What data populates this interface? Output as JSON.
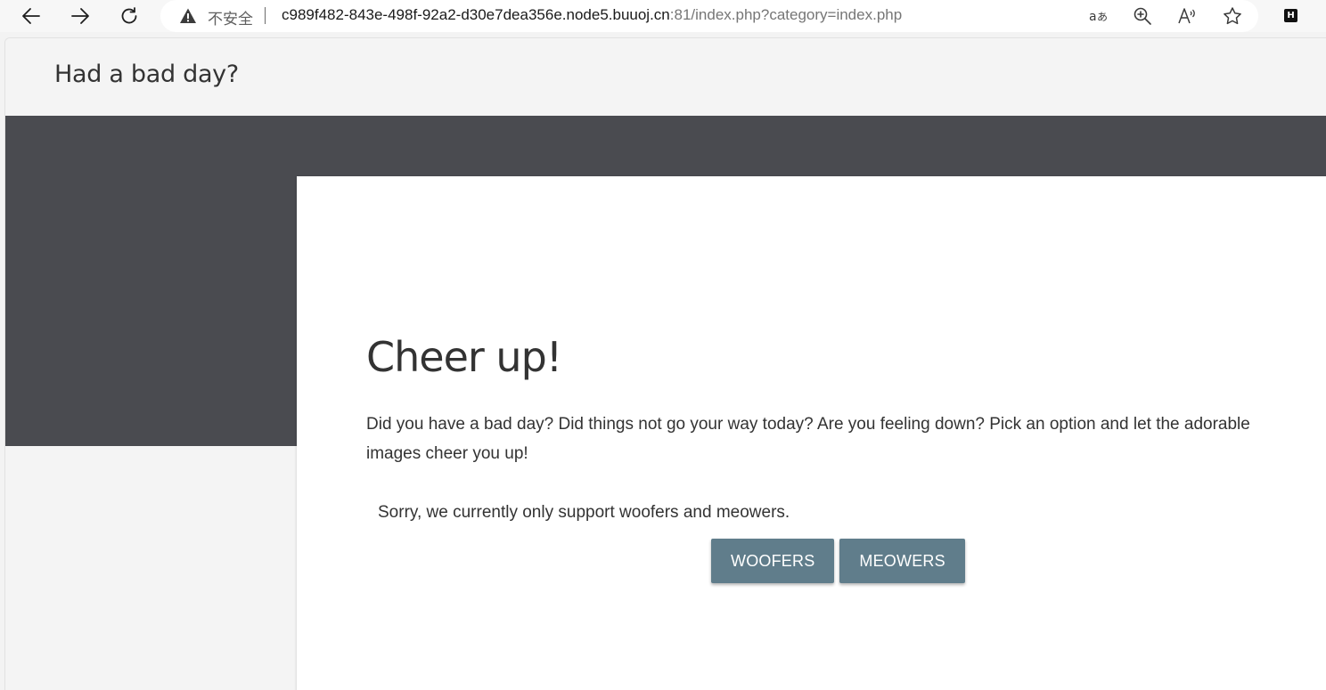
{
  "browser": {
    "security_label": "不安全",
    "url_host": "c989f482-843e-498f-92a2-d30e7dea356e.node5.buuoj.cn",
    "url_path": ":81/index.php?category=index.php",
    "icons": [
      "back-arrow-icon",
      "forward-arrow-icon",
      "refresh-icon",
      "warning-icon",
      "translate-icon",
      "zoom-icon",
      "read-aloud-icon",
      "favorite-star-icon",
      "extension-icon"
    ],
    "extension_letter": "H"
  },
  "header": {
    "title": "Had a bad day?"
  },
  "card": {
    "heading": "Cheer up!",
    "paragraph": "Did you have a bad day? Did things not go your way today? Are you feeling down? Pick an option and let the adorable images cheer you up!",
    "notice": "Sorry, we currently only support woofers and meowers.",
    "buttons": [
      {
        "label": "WOOFERS"
      },
      {
        "label": "MEOWERS"
      }
    ]
  },
  "colors": {
    "hero_band": "#4a4b50",
    "button": "#607d8b",
    "page_bg": "#f4f4f4"
  }
}
